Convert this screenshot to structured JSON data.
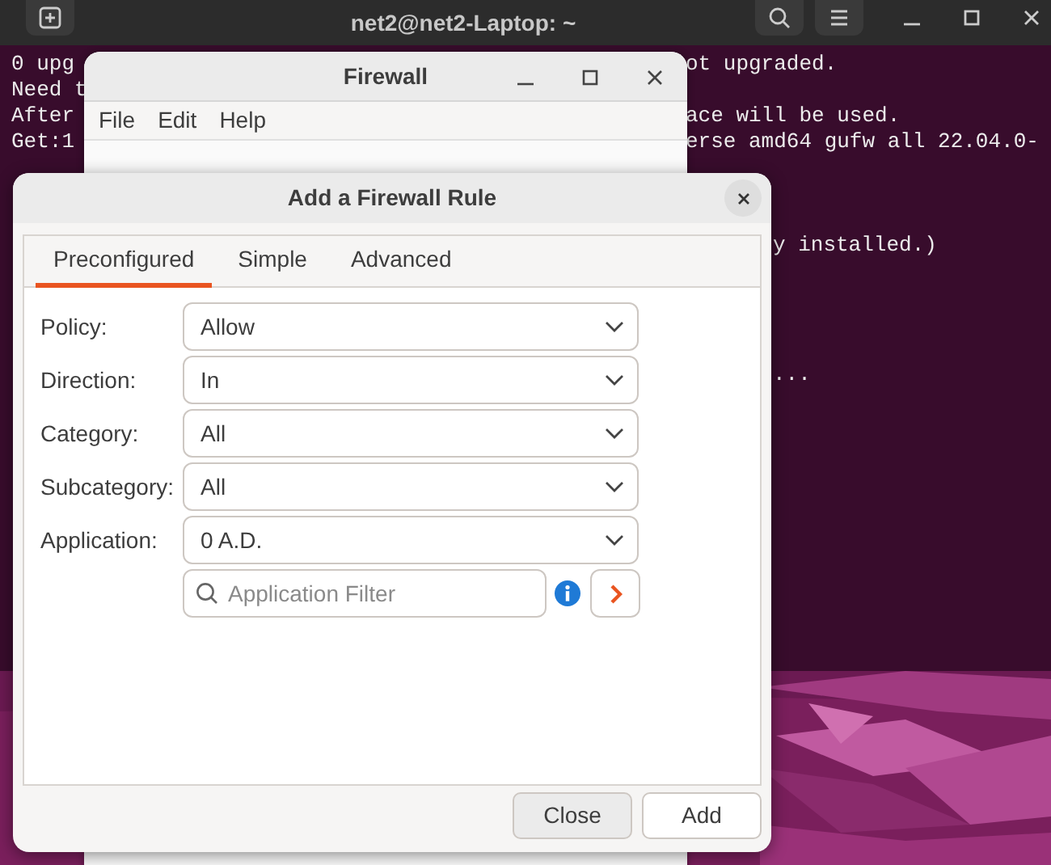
{
  "terminal": {
    "title": "net2@net2-Laptop: ~",
    "lines": [
      {
        "left": "0 upg",
        "right": "ot upgraded."
      },
      {
        "left": "Need t"
      },
      {
        "left": "After",
        "right": "ace will be used."
      },
      {
        "left": "Get:1",
        "right": "erse amd64 gufw all 22.04.0-"
      }
    ],
    "lower_lines": [
      "y installed.)",
      "..."
    ]
  },
  "firewall_window": {
    "title": "Firewall",
    "menu": [
      "File",
      "Edit",
      "Help"
    ]
  },
  "dialog": {
    "title": "Add a Firewall Rule",
    "tabs": [
      {
        "label": "Preconfigured",
        "selected": true
      },
      {
        "label": "Simple",
        "selected": false
      },
      {
        "label": "Advanced",
        "selected": false
      }
    ],
    "fields": [
      {
        "label": "Policy:",
        "value": "Allow"
      },
      {
        "label": "Direction:",
        "value": "In"
      },
      {
        "label": "Category:",
        "value": "All"
      },
      {
        "label": "Subcategory:",
        "value": "All"
      },
      {
        "label": "Application:",
        "value": "0 A.D."
      }
    ],
    "filter": {
      "placeholder": "Application Filter"
    },
    "buttons": [
      {
        "label": "Close",
        "highlighted": true
      },
      {
        "label": "Add",
        "highlighted": false
      }
    ]
  }
}
